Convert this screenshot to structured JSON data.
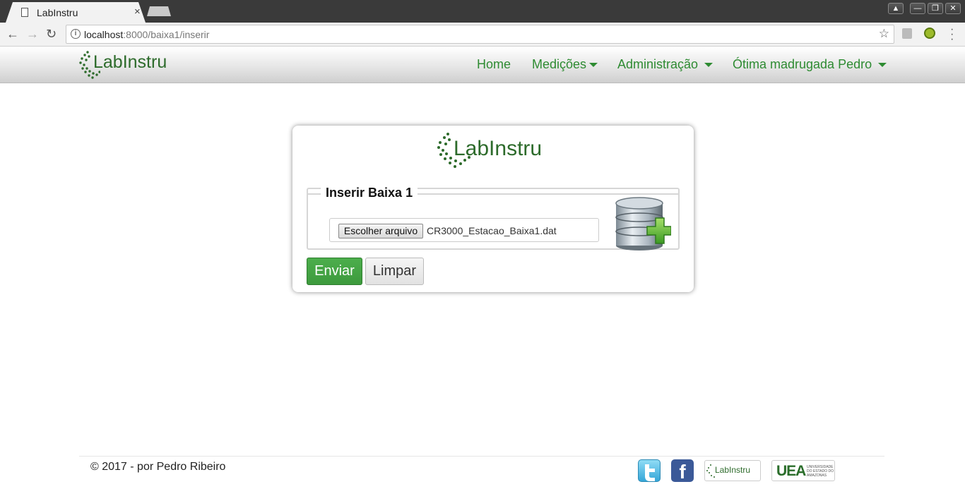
{
  "browser": {
    "tab_title": "LabInstru",
    "tab_close": "×",
    "url_host": "localhost",
    "url_rest": ":8000/baixa1/inserir",
    "window_buttons": [
      "▲",
      "—",
      "❐",
      "✕"
    ]
  },
  "navbar": {
    "brand": "LabInstru",
    "links": [
      {
        "label": "Home",
        "dropdown": false
      },
      {
        "label": "Medições",
        "dropdown": true
      },
      {
        "label": "Administração",
        "dropdown": true
      },
      {
        "label": "Ótima madrugada Pedro",
        "dropdown": true
      }
    ]
  },
  "form": {
    "logo_text": "LabInstru",
    "legend": "Inserir Baixa 1",
    "file_button": "Escolher arquivo",
    "file_name": "CR3000_Estacao_Baixa1.dat",
    "submit_label": "Enviar",
    "reset_label": "Limpar"
  },
  "footer": {
    "copyright": "© 2017 - por Pedro Ribeiro",
    "badges": {
      "facebook": "f",
      "labinstru": "LabInstru",
      "uea": "UEA",
      "uea_sub": "UNIVERSIDADE DO ESTADO DO AMAZONAS"
    }
  },
  "colors": {
    "brand_green": "#2e8b32",
    "logo_green": "#2d6b2b",
    "button_green": "#4cae4c"
  },
  "icons": [
    "page-icon",
    "back-arrow-icon",
    "forward-arrow-icon",
    "reload-icon",
    "info-icon",
    "star-icon",
    "database-add-icon",
    "twitter-icon",
    "facebook-icon"
  ]
}
